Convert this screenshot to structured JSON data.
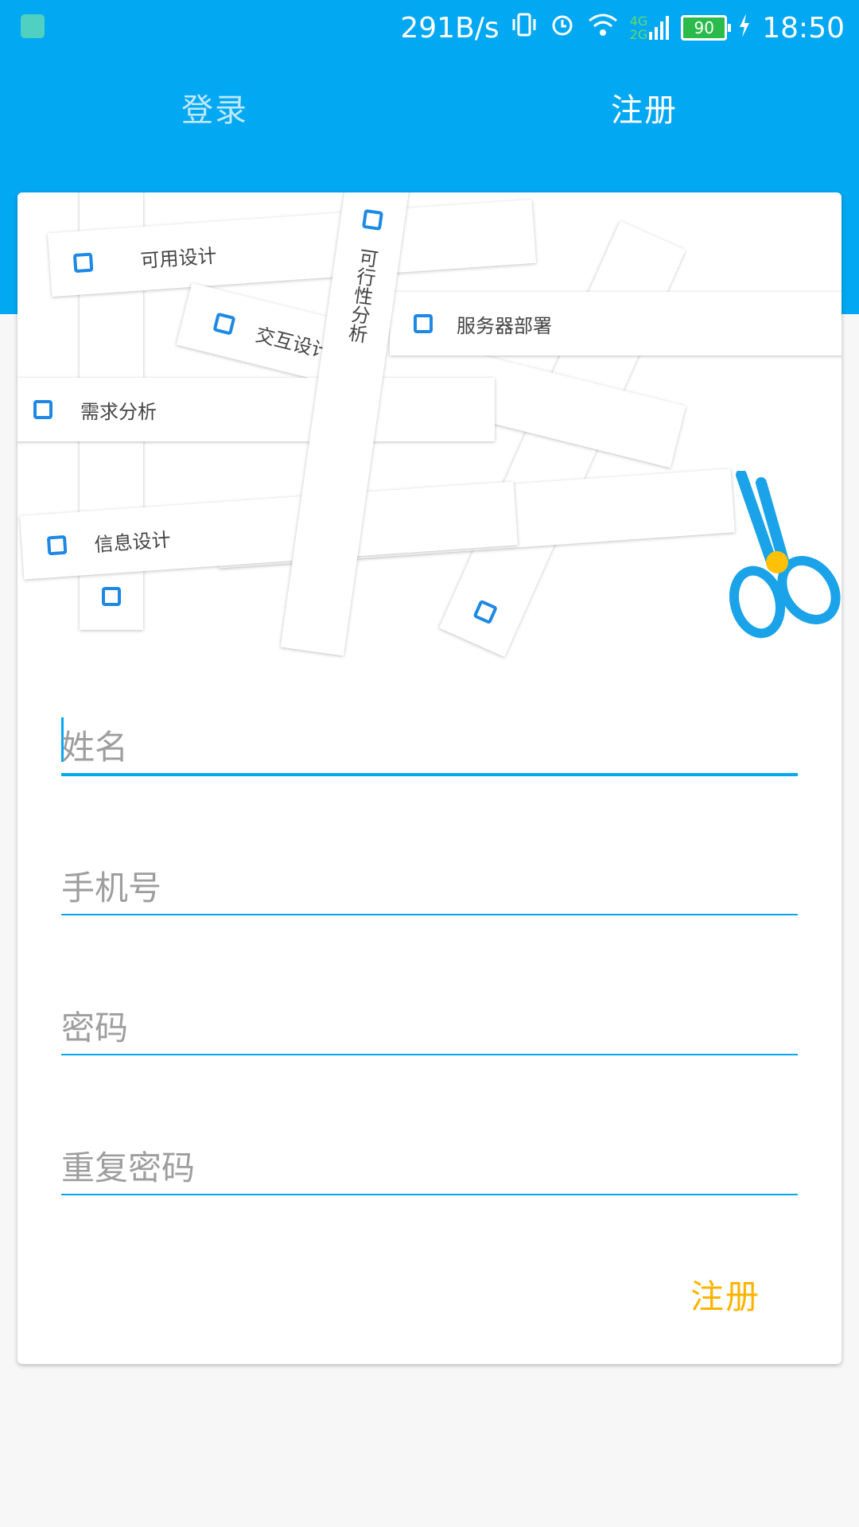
{
  "status_bar": {
    "speed": "291B/s",
    "network_labels": [
      "4G",
      "2G"
    ],
    "battery": "90",
    "time": "18:50"
  },
  "tabs": [
    {
      "label": "登录",
      "active": false
    },
    {
      "label": "注册",
      "active": true
    }
  ],
  "illustration": {
    "tasks": [
      "交互设计",
      "可行性分析",
      "服务器部署",
      "需求分析",
      "信息设计",
      "可用设计"
    ]
  },
  "form": {
    "name_placeholder": "姓名",
    "phone_placeholder": "手机号",
    "password_placeholder": "密码",
    "repeat_password_placeholder": "重复密码",
    "submit_label": "注册"
  },
  "colors": {
    "primary": "#03a8f2",
    "accent": "#ffb300",
    "checkbox": "#1e88e5"
  }
}
